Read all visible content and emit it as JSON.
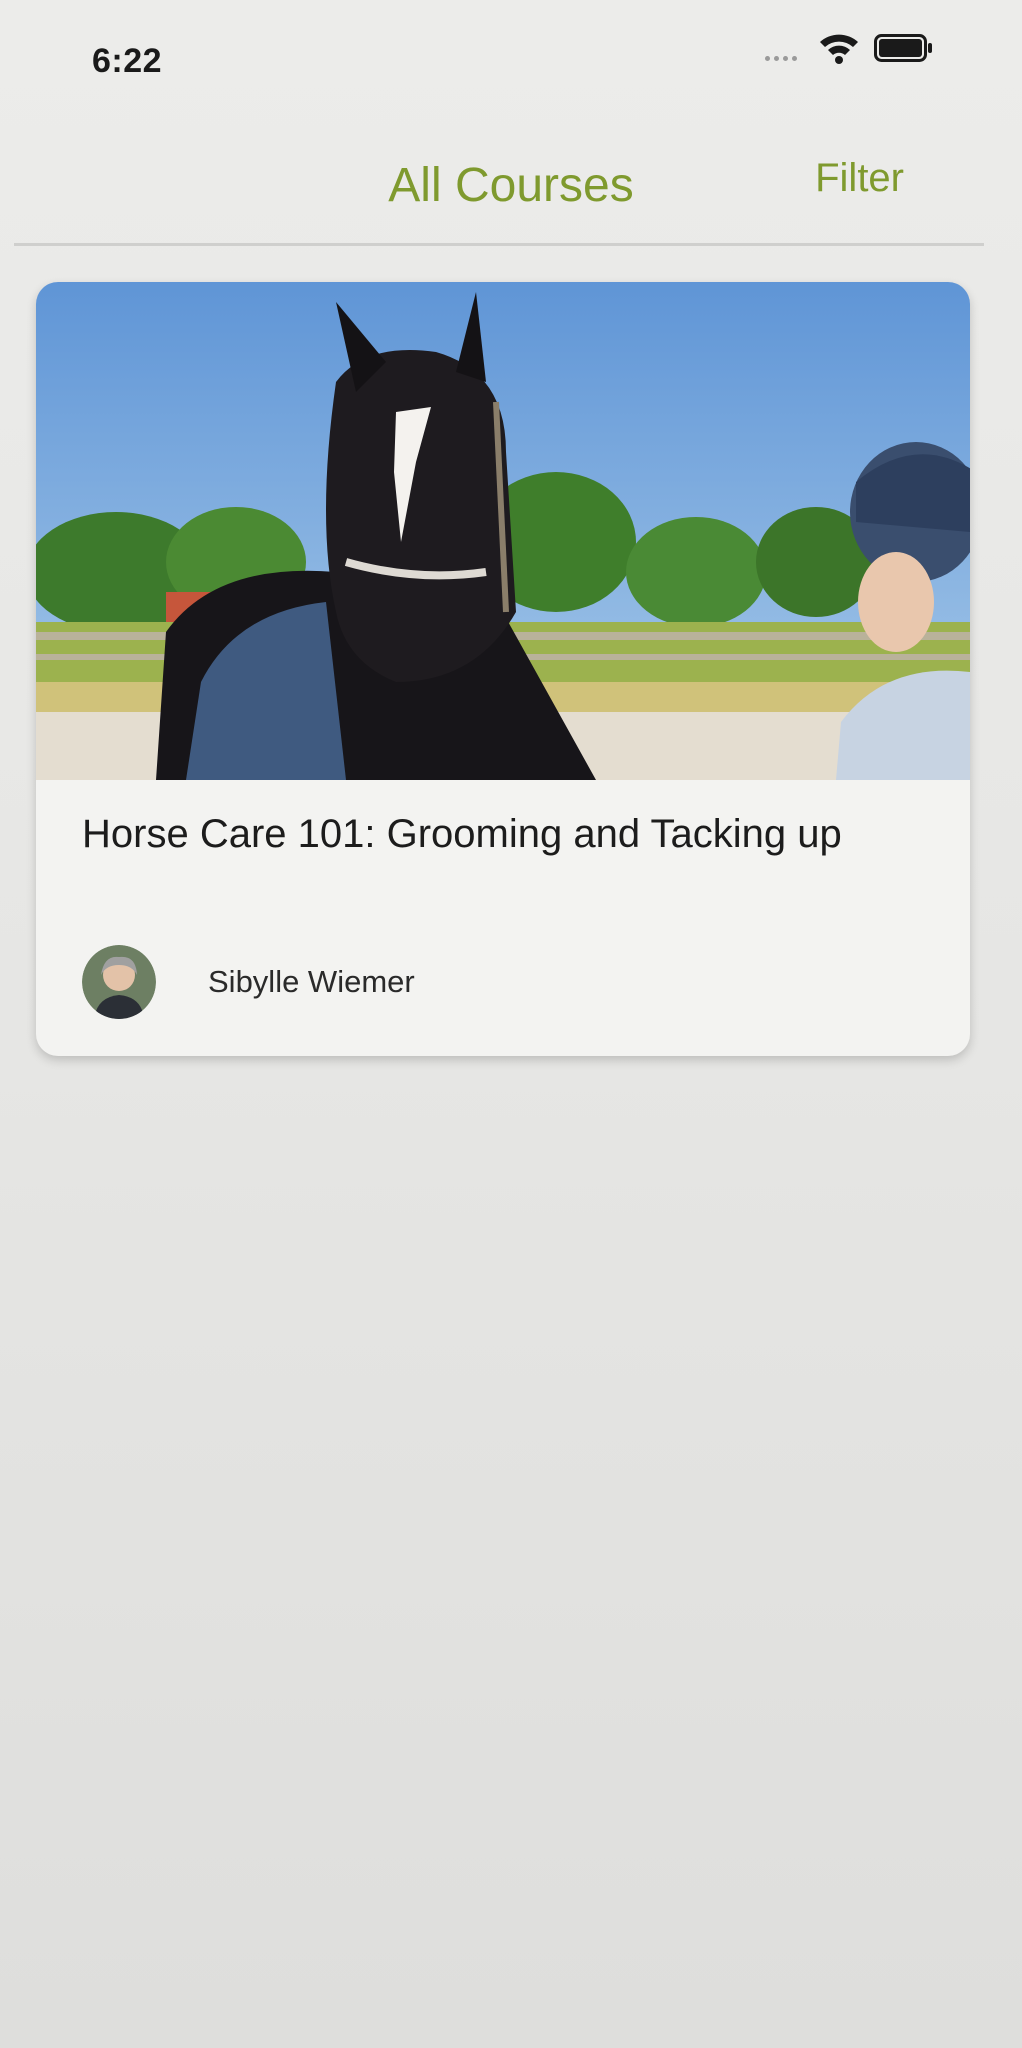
{
  "status_bar": {
    "time": "6:22",
    "wifi_icon": "wifi-icon",
    "battery_icon": "battery-icon"
  },
  "nav": {
    "title": "All Courses",
    "filter_label": "Filter",
    "accent_color": "#7f9a2e"
  },
  "courses": [
    {
      "title": "Horse Care 101: Grooming and Tacking up",
      "author": "Sibylle Wiemer",
      "image": "horse-photo",
      "author_avatar": "author-avatar"
    }
  ]
}
